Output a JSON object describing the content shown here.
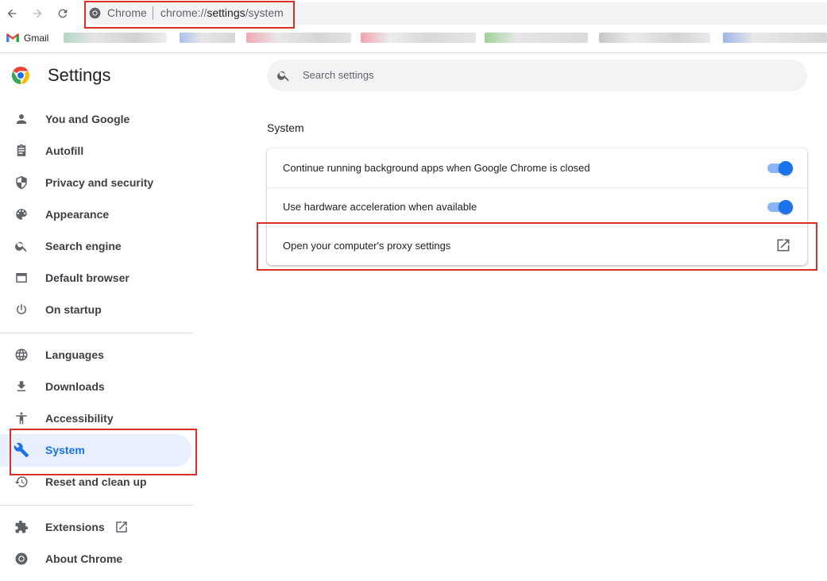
{
  "browser": {
    "site_chip": "Chrome",
    "url_prefix": "chrome://",
    "url_host": "settings",
    "url_path": "/system"
  },
  "bookmarks": {
    "items": [
      {
        "label": "Gmail",
        "icon": "gmail-icon"
      }
    ]
  },
  "sidebar": {
    "title": "Settings",
    "items": [
      {
        "label": "You and Google",
        "icon": "person-icon"
      },
      {
        "label": "Autofill",
        "icon": "clipboard-icon"
      },
      {
        "label": "Privacy and security",
        "icon": "shield-icon"
      },
      {
        "label": "Appearance",
        "icon": "palette-icon"
      },
      {
        "label": "Search engine",
        "icon": "search-icon"
      },
      {
        "label": "Default browser",
        "icon": "browser-window-icon"
      },
      {
        "label": "On startup",
        "icon": "power-icon"
      },
      {
        "label": "Languages",
        "icon": "globe-icon"
      },
      {
        "label": "Downloads",
        "icon": "download-icon"
      },
      {
        "label": "Accessibility",
        "icon": "accessibility-icon"
      },
      {
        "label": "System",
        "icon": "wrench-icon",
        "active": true
      },
      {
        "label": "Reset and clean up",
        "icon": "history-icon"
      },
      {
        "label": "Extensions",
        "icon": "puzzle-icon"
      },
      {
        "label": "About Chrome",
        "icon": "chrome-icon"
      }
    ]
  },
  "search": {
    "placeholder": "Search settings"
  },
  "main": {
    "section_title": "System",
    "rows": [
      {
        "label": "Continue running background apps when Google Chrome is closed",
        "control": "toggle",
        "on": true
      },
      {
        "label": "Use hardware acceleration when available",
        "control": "toggle",
        "on": true
      },
      {
        "label": "Open your computer's proxy settings",
        "control": "external-link"
      }
    ]
  },
  "colors": {
    "accent": "#1a73e8",
    "active_bg": "#e8f0fe",
    "highlight": "#d93025"
  }
}
